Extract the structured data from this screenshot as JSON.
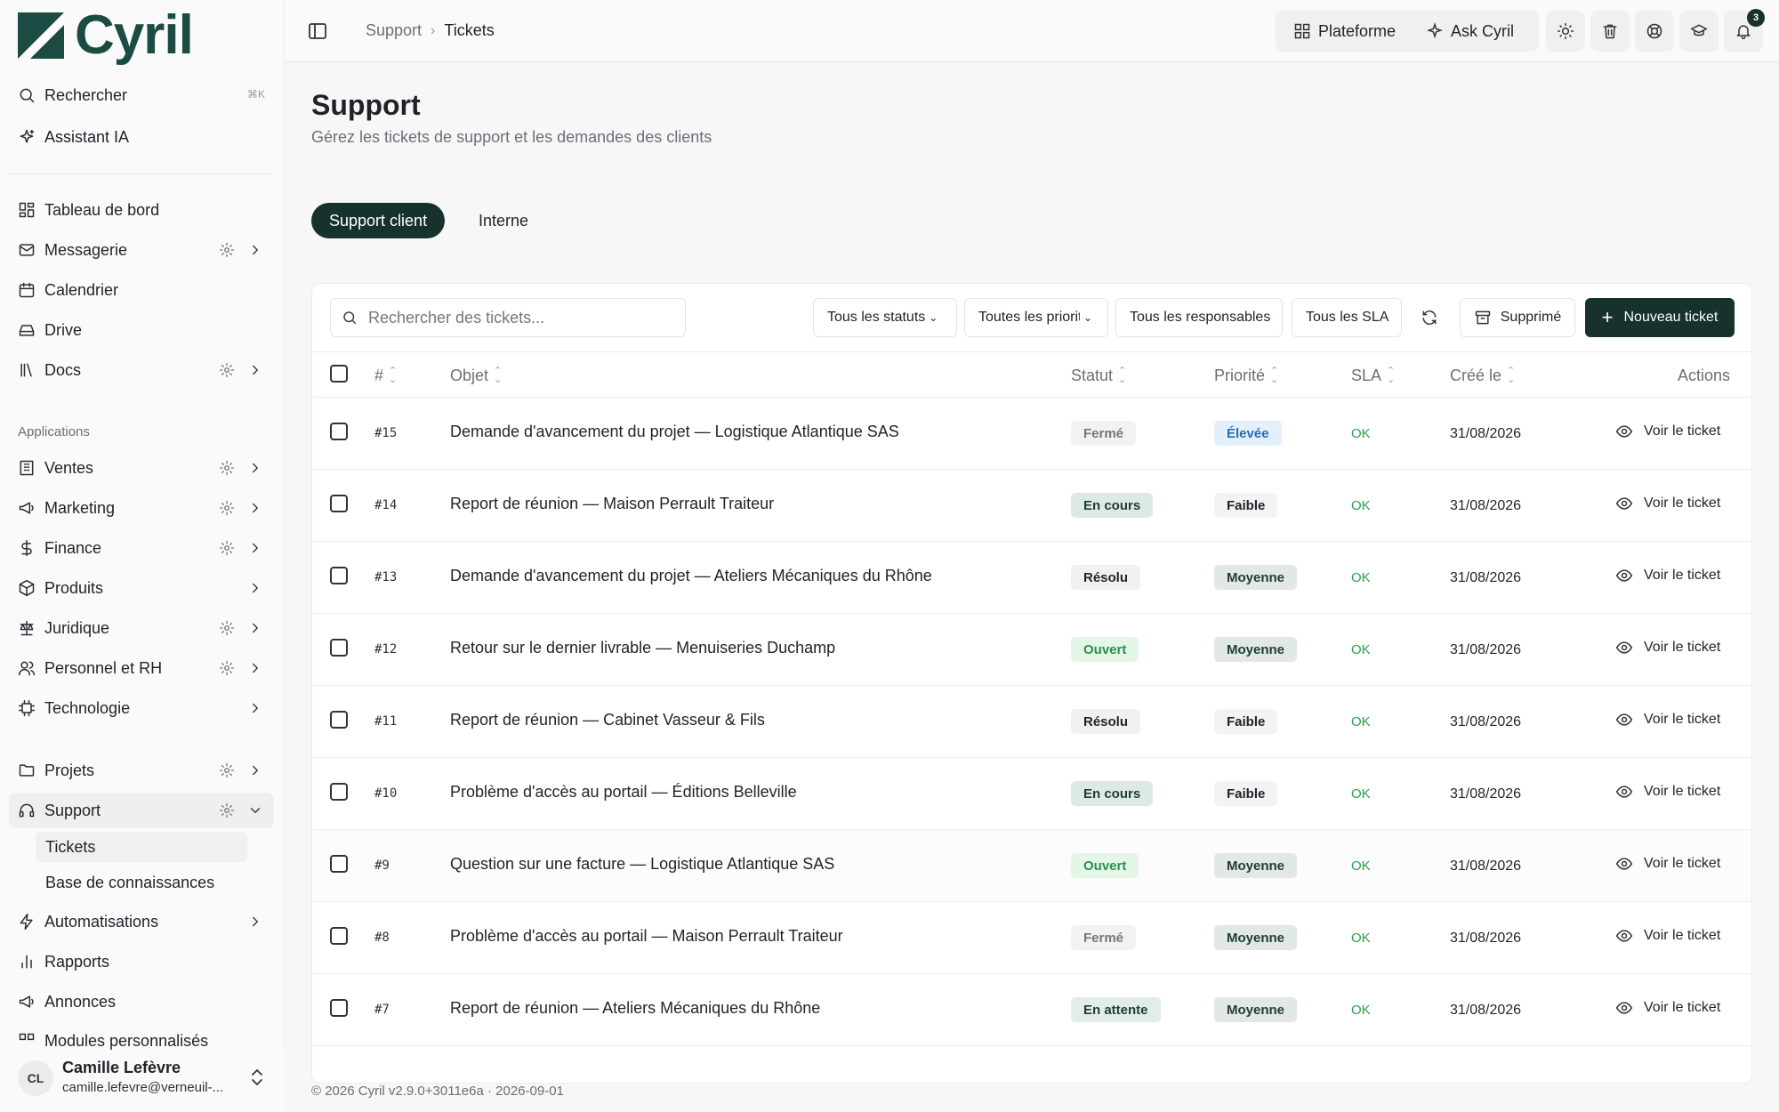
{
  "app": {
    "logo_text": "Cyril"
  },
  "sidebar": {
    "search_label": "Rechercher",
    "search_shortcut": "⌘K",
    "assistant_label": "Assistant IA",
    "main_items": [
      {
        "label": "Tableau de bord",
        "icon": "dashboard-icon"
      },
      {
        "label": "Messagerie",
        "icon": "mail-icon",
        "gear": true,
        "chevron": true
      },
      {
        "label": "Calendrier",
        "icon": "calendar-icon"
      },
      {
        "label": "Drive",
        "icon": "drive-icon"
      },
      {
        "label": "Docs",
        "icon": "library-icon",
        "gear": true,
        "chevron": true
      }
    ],
    "applications_label": "Applications",
    "app_items": [
      {
        "label": "Ventes",
        "icon": "building-icon",
        "gear": true,
        "chevron": true
      },
      {
        "label": "Marketing",
        "icon": "megaphone-icon",
        "gear": true,
        "chevron": true
      },
      {
        "label": "Finance",
        "icon": "dollar-icon",
        "gear": true,
        "chevron": true
      },
      {
        "label": "Produits",
        "icon": "package-icon",
        "chevron": true
      },
      {
        "label": "Juridique",
        "icon": "scale-icon",
        "gear": true,
        "chevron": true
      },
      {
        "label": "Personnel et RH",
        "icon": "users-icon",
        "gear": true,
        "chevron": true
      },
      {
        "label": "Technologie",
        "icon": "chip-icon",
        "chevron": true
      }
    ],
    "projects_label": "Projets",
    "support_label": "Support",
    "support_children": [
      "Tickets",
      "Base de connaissances"
    ],
    "bottom_items": [
      {
        "label": "Automatisations",
        "icon": "bolt-icon",
        "chevron": true
      },
      {
        "label": "Rapports",
        "icon": "chart-icon"
      },
      {
        "label": "Annonces",
        "icon": "megaphone-icon"
      }
    ],
    "cut_item_label": "Modules personnalisés",
    "user": {
      "initials": "CL",
      "name": "Camille Lefèvre",
      "email": "camille.lefevre@verneuil-..."
    }
  },
  "topbar": {
    "breadcrumb": [
      "Support",
      "Tickets"
    ],
    "platform_label": "Plateforme",
    "ask_label": "Ask Cyril",
    "notifications_count": "3"
  },
  "page": {
    "title": "Support",
    "subtitle": "Gérez les tickets de support et les demandes des clients",
    "tabs": [
      "Support client",
      "Interne"
    ]
  },
  "toolbar": {
    "search_placeholder": "Rechercher des tickets...",
    "filters": [
      "Tous les statuts",
      "Toutes les priorités",
      "Tous les responsables",
      "Tous les SLA"
    ],
    "trash_label": "Supprimé",
    "new_label": "Nouveau ticket"
  },
  "table": {
    "headers": {
      "num": "#",
      "subject": "Objet",
      "status": "Statut",
      "priority": "Priorité",
      "sla": "SLA",
      "created": "Créé le",
      "actions": "Actions"
    },
    "action_label": "Voir le ticket",
    "rows": [
      {
        "num": "#15",
        "subject": "Demande d'avancement du projet — Logistique Atlantique SAS",
        "status": "Fermé",
        "priority": "Élevée",
        "sla": "OK",
        "created": "31/08/2026"
      },
      {
        "num": "#14",
        "subject": "Report de réunion — Maison Perrault Traiteur",
        "status": "En cours",
        "priority": "Faible",
        "sla": "OK",
        "created": "31/08/2026"
      },
      {
        "num": "#13",
        "subject": "Demande d'avancement du projet — Ateliers Mécaniques du Rhône",
        "status": "Résolu",
        "priority": "Moyenne",
        "sla": "OK",
        "created": "31/08/2026"
      },
      {
        "num": "#12",
        "subject": "Retour sur le dernier livrable — Menuiseries Duchamp",
        "status": "Ouvert",
        "priority": "Moyenne",
        "sla": "OK",
        "created": "31/08/2026"
      },
      {
        "num": "#11",
        "subject": "Report de réunion — Cabinet Vasseur & Fils",
        "status": "Résolu",
        "priority": "Faible",
        "sla": "OK",
        "created": "31/08/2026"
      },
      {
        "num": "#10",
        "subject": "Problème d'accès au portail — Éditions Belleville",
        "status": "En cours",
        "priority": "Faible",
        "sla": "OK",
        "created": "31/08/2026"
      },
      {
        "num": "#9",
        "subject": "Question sur une facture — Logistique Atlantique SAS",
        "status": "Ouvert",
        "priority": "Moyenne",
        "sla": "OK",
        "created": "31/08/2026"
      },
      {
        "num": "#8",
        "subject": "Problème d'accès au portail — Maison Perrault Traiteur",
        "status": "Fermé",
        "priority": "Moyenne",
        "sla": "OK",
        "created": "31/08/2026"
      },
      {
        "num": "#7",
        "subject": "Report de réunion — Ateliers Mécaniques du Rhône",
        "status": "En attente",
        "priority": "Moyenne",
        "sla": "OK",
        "created": "31/08/2026"
      }
    ]
  },
  "colors": {
    "accent": "#17322c",
    "status": {
      "Fermé": {
        "bg": "#f2f2f2",
        "fg": "#777777"
      },
      "En cours": {
        "bg": "#dde9e5",
        "fg": "#1f3d36"
      },
      "Résolu": {
        "bg": "#f1f1f1",
        "fg": "#1f2328"
      },
      "Ouvert": {
        "bg": "#e4f6e8",
        "fg": "#2e8f4c"
      },
      "En attente": {
        "bg": "#e2ece8",
        "fg": "#1f3d36"
      }
    },
    "priority": {
      "Élevée": {
        "bg": "#e3f0fb",
        "fg": "#2b6cb0"
      },
      "Faible": {
        "bg": "#f3f3f3",
        "fg": "#1f2328"
      },
      "Moyenne": {
        "bg": "#e1e8e6",
        "fg": "#1f3d36"
      }
    }
  },
  "footer": {
    "text": "© 2026 Cyril v2.9.0+3011e6a · 2026-09-01"
  }
}
